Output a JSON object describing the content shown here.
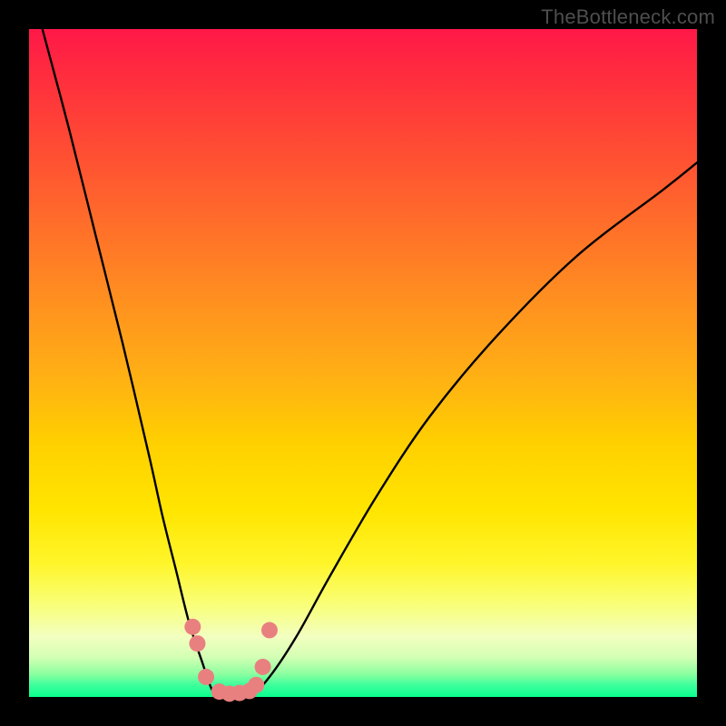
{
  "watermark": "TheBottleneck.com",
  "chart_data": {
    "type": "line",
    "title": "",
    "xlabel": "",
    "ylabel": "",
    "xlim": [
      0,
      100
    ],
    "ylim": [
      0,
      100
    ],
    "series": [
      {
        "name": "bottleneck-curve",
        "x": [
          2,
          6,
          10,
          14,
          18,
          20,
          22,
          24,
          26,
          27,
          28,
          29,
          30,
          33,
          36,
          40,
          45,
          52,
          60,
          70,
          82,
          95,
          100
        ],
        "values": [
          100,
          85,
          69,
          53,
          36,
          27,
          19,
          11,
          5,
          2,
          0,
          0,
          0,
          0,
          3,
          9,
          18,
          30,
          42,
          54,
          66,
          76,
          80
        ]
      },
      {
        "name": "marker-dots",
        "x": [
          24.5,
          25.2,
          26.5,
          28.5,
          30.0,
          31.5,
          33.0,
          34.0,
          35.0,
          36.0
        ],
        "values": [
          10.5,
          8.0,
          3.0,
          0.8,
          0.5,
          0.6,
          0.9,
          1.8,
          4.5,
          10.0
        ]
      }
    ],
    "colors": {
      "curve": "#000000",
      "dots": "#e98080"
    }
  }
}
